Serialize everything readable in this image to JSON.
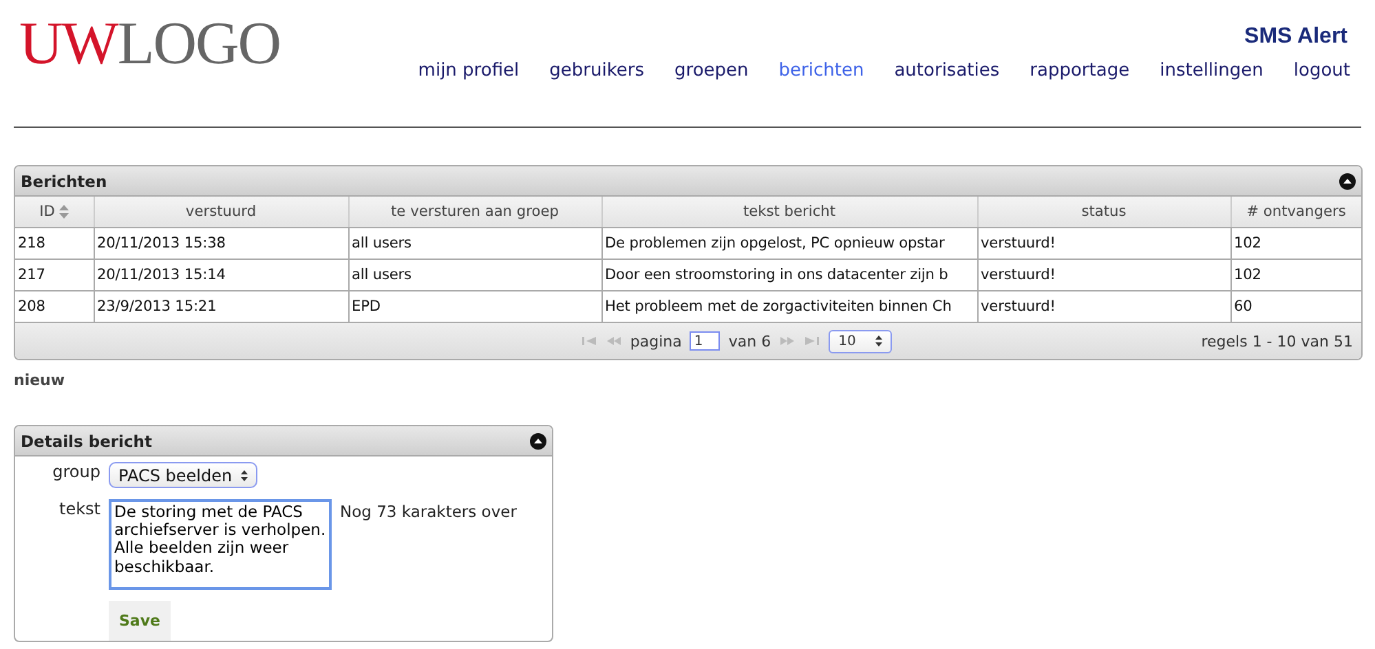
{
  "logo": {
    "part_1": "UW",
    "part_2": "LOGO"
  },
  "app_title": "SMS Alert",
  "nav": [
    {
      "label": "mijn profiel",
      "selected": false
    },
    {
      "label": "gebruikers",
      "selected": false
    },
    {
      "label": "groepen",
      "selected": false
    },
    {
      "label": "berichten",
      "selected": true
    },
    {
      "label": "autorisaties",
      "selected": false
    },
    {
      "label": "rapportage",
      "selected": false
    },
    {
      "label": "instellingen",
      "selected": false
    },
    {
      "label": "logout",
      "selected": false
    }
  ],
  "messages_panel": {
    "title": "Berichten",
    "columns": [
      "ID",
      "verstuurd",
      "te versturen aan groep",
      "tekst bericht",
      "status",
      "# ontvangers"
    ],
    "rows": [
      [
        "218",
        "20/11/2013 15:38",
        "all users",
        "De problemen zijn opgelost, PC opnieuw opstar",
        "verstuurd!",
        "102"
      ],
      [
        "217",
        "20/11/2013 15:14",
        "all users",
        "Door een stroomstoring in ons datacenter zijn b",
        "verstuurd!",
        "102"
      ],
      [
        "208",
        "23/9/2013 15:21",
        "EPD",
        "Het probleem met de zorgactiviteiten binnen Ch",
        "verstuurd!",
        "60"
      ]
    ],
    "pager": {
      "page_label": "pagina",
      "page": "1",
      "of_label": "van 6",
      "page_size": "10",
      "summary": "regels 1 - 10 van 51"
    }
  },
  "new_link": "nieuw",
  "details_panel": {
    "title": "Details bericht",
    "group_label": "group",
    "group_value": "PACS beelden",
    "text_label": "tekst",
    "text_value": "De storing met de PACS archiefserver is verholpen. Alle beelden zijn weer beschikbaar.",
    "remaining": "Nog 73 karakters over",
    "save": "Save"
  }
}
